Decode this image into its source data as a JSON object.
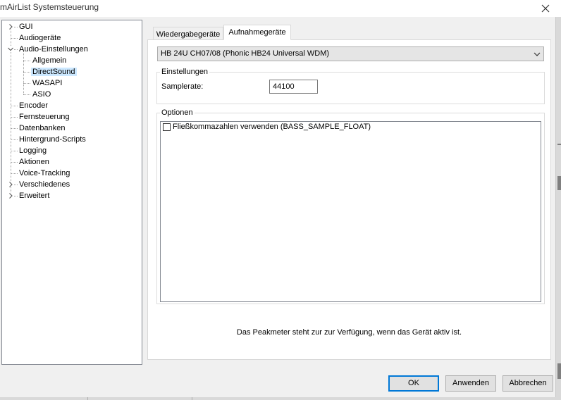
{
  "window": {
    "title": "mAirList Systemsteuerung",
    "close_icon": "close-icon"
  },
  "tree": {
    "items": [
      {
        "label": "GUI",
        "expander": "collapsed"
      },
      {
        "label": "Audiogeräte"
      },
      {
        "label": "Audio-Einstellungen",
        "expander": "expanded"
      },
      {
        "label": "Allgemein"
      },
      {
        "label": "DirectSound",
        "selected": true
      },
      {
        "label": "WASAPI"
      },
      {
        "label": "ASIO"
      },
      {
        "label": "Encoder"
      },
      {
        "label": "Fernsteuerung"
      },
      {
        "label": "Datenbanken"
      },
      {
        "label": "Hintergrund-Scripts"
      },
      {
        "label": "Logging"
      },
      {
        "label": "Aktionen"
      },
      {
        "label": "Voice-Tracking"
      },
      {
        "label": "Verschiedenes",
        "expander": "collapsed"
      },
      {
        "label": "Erweitert",
        "expander": "collapsed"
      }
    ]
  },
  "tabs": [
    {
      "label": "Wiedergabegeräte",
      "active": false
    },
    {
      "label": "Aufnahmegeräte",
      "active": true
    }
  ],
  "device_select": {
    "value": "HB 24U CH07/08 (Phonic HB24 Universal WDM)"
  },
  "settings_group": {
    "label": "Einstellungen",
    "samplerate_label": "Samplerate:",
    "samplerate_value": "44100"
  },
  "options_group": {
    "label": "Optionen",
    "float_checkbox_label": "Fließkommazahlen verwenden (BASS_SAMPLE_FLOAT)",
    "float_checked": false
  },
  "peakmeter_text": "Das Peakmeter steht zur zur Verfügung, wenn das Gerät aktiv ist.",
  "buttons": {
    "ok": "OK",
    "apply": "Anwenden",
    "cancel": "Abbrechen"
  },
  "colors": {
    "selection": "#cce8ff",
    "primary_border": "#0078d7",
    "window_bg": "#f0f0f0"
  }
}
